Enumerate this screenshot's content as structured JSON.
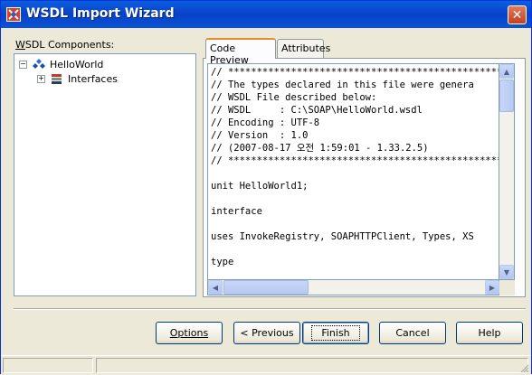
{
  "window": {
    "title": "WSDL Import Wizard"
  },
  "left_panel": {
    "label_prefix": "W",
    "label_rest": "SDL Components:",
    "tree": [
      {
        "label": "HelloWorld",
        "expander": "−",
        "icon": "service-diamond-icon"
      },
      {
        "label": "Interfaces",
        "expander": "+",
        "icon": "interfaces-books-icon"
      }
    ]
  },
  "tabs": [
    {
      "label": "Code Preview",
      "active": true
    },
    {
      "label": "Attributes",
      "active": false
    }
  ],
  "code_lines": [
    "// ************************************************",
    "// The types declared in this file were genera",
    "// WSDL File described below:",
    "// WSDL     : C:\\SOAP\\HelloWorld.wsdl",
    "// Encoding : UTF-8",
    "// Version  : 1.0",
    "// (2007-08-17 오전 1:59:01 - 1.33.2.5)",
    "// ************************************************",
    "",
    "unit HelloWorld1;",
    "",
    "interface",
    "",
    "uses InvokeRegistry, SOAPHTTPClient, Types, XS",
    "",
    "type"
  ],
  "buttons": {
    "options": "Options",
    "previous": "< Previous",
    "finish": "Finish",
    "cancel": "Cancel",
    "help": "Help"
  },
  "scrollbars": {
    "up": "▲",
    "down": "▼",
    "left": "◀",
    "right": "▶"
  },
  "colors": {
    "title_bar": "#0a54d6",
    "close": "#c4401e",
    "tab_highlight": "#e68b2c"
  }
}
